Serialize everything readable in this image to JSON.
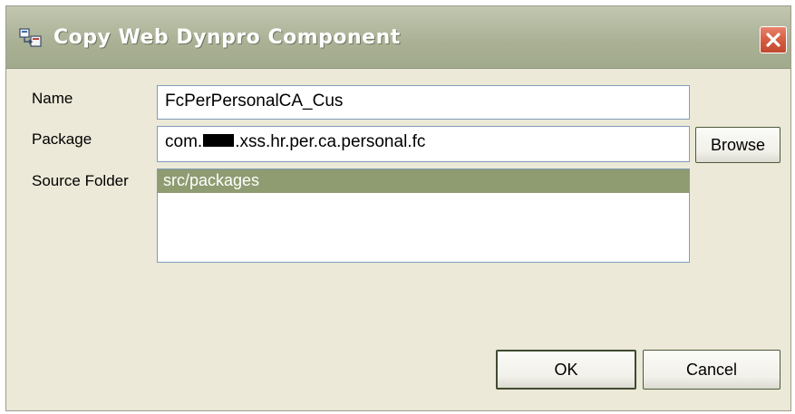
{
  "dialog": {
    "title": "Copy Web Dynpro Component",
    "close_label": "×"
  },
  "form": {
    "name_label": "Name",
    "name_value": "FcPerPersonalCA_Cus",
    "package_label": "Package",
    "package_prefix": "com.",
    "package_suffix": ".xss.hr.per.ca.personal.fc",
    "browse_label": "Browse",
    "source_folder_label": "Source Folder",
    "source_folders": [
      "src/packages"
    ]
  },
  "buttons": {
    "ok_label": "OK",
    "cancel_label": "Cancel"
  },
  "colors": {
    "title_bar": "#a9b094",
    "selection": "#8f9b71",
    "dialog_bg": "#ece9d8",
    "close_button": "#d45a3f"
  }
}
